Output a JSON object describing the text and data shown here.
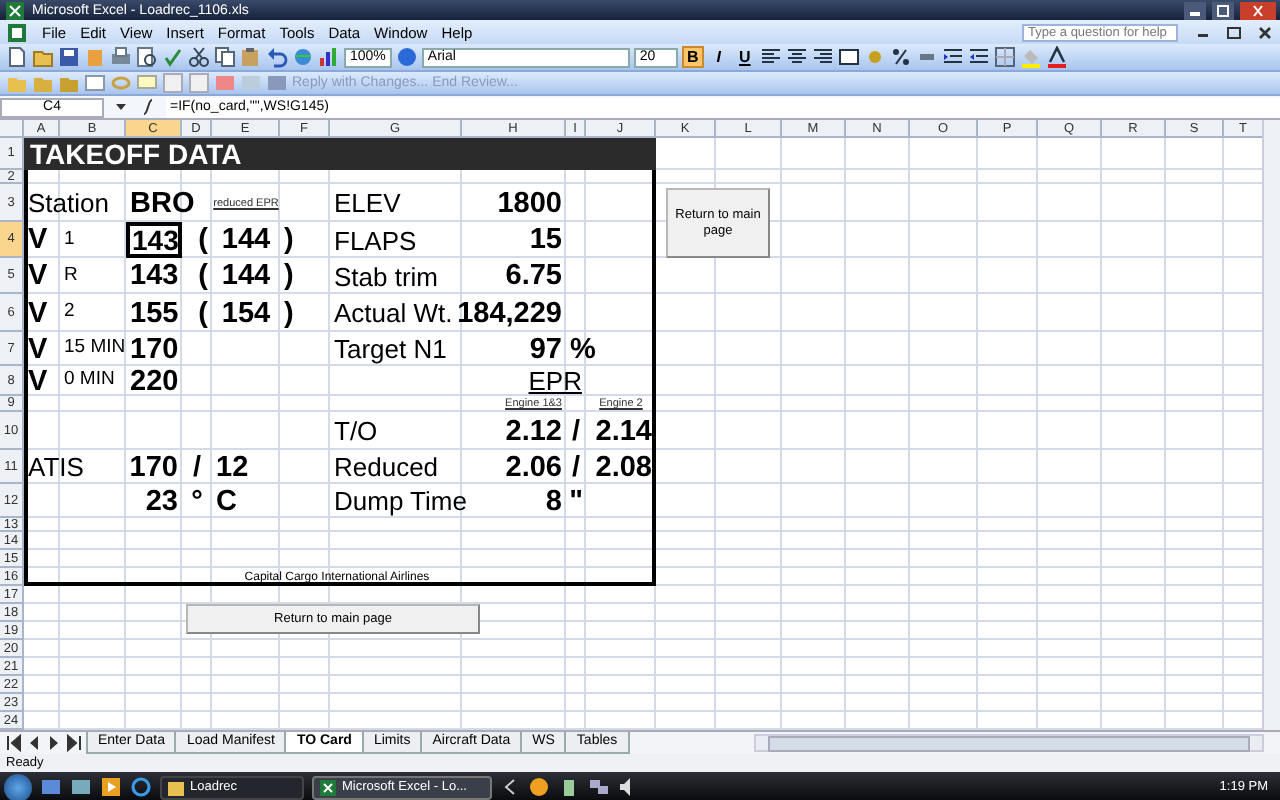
{
  "window": {
    "title": "Microsoft Excel - Loadrec_1106.xls"
  },
  "menu": [
    "File",
    "Edit",
    "View",
    "Insert",
    "Format",
    "Tools",
    "Data",
    "Window",
    "Help"
  ],
  "help": {
    "placeholder": "Type a question for help"
  },
  "toolbar": {
    "zoom": "100%",
    "font": "Arial",
    "size": "20",
    "format_buttons": [
      {
        "kind": "bold",
        "label": "B",
        "on": true
      },
      {
        "kind": "italic",
        "label": "I",
        "on": false
      },
      {
        "kind": "underline",
        "label": "U",
        "on": false
      }
    ]
  },
  "review": {
    "items": [
      "Reply with Changes...",
      "End Review..."
    ],
    "disabled": true
  },
  "formula_bar": {
    "name_box": "C4",
    "formula": "=IF(no_card,\"\",WS!G145)"
  },
  "columns": [
    {
      "label": "A",
      "selected": false
    },
    {
      "label": "B",
      "selected": false
    },
    {
      "label": "C",
      "selected": true
    },
    {
      "label": "D",
      "selected": false
    },
    {
      "label": "E",
      "selected": false
    },
    {
      "label": "F",
      "selected": false
    },
    {
      "label": "G",
      "selected": false
    },
    {
      "label": "H",
      "selected": false
    },
    {
      "label": "I",
      "selected": false
    },
    {
      "label": "J",
      "selected": false
    },
    {
      "label": "K",
      "selected": false
    },
    {
      "label": "L",
      "selected": false
    },
    {
      "label": "M",
      "selected": false
    },
    {
      "label": "N",
      "selected": false
    },
    {
      "label": "O",
      "selected": false
    },
    {
      "label": "P",
      "selected": false
    },
    {
      "label": "Q",
      "selected": false
    },
    {
      "label": "R",
      "selected": false
    },
    {
      "label": "S",
      "selected": false
    },
    {
      "label": "T",
      "selected": false
    }
  ],
  "rows": [
    {
      "label": "1",
      "selected": false
    },
    {
      "label": "2",
      "selected": false
    },
    {
      "label": "3",
      "selected": false
    },
    {
      "label": "4",
      "selected": true
    },
    {
      "label": "5",
      "selected": false
    },
    {
      "label": "6",
      "selected": false
    },
    {
      "label": "7",
      "selected": false
    },
    {
      "label": "8",
      "selected": false
    },
    {
      "label": "9",
      "selected": false
    },
    {
      "label": "10",
      "selected": false
    },
    {
      "label": "11",
      "selected": false
    },
    {
      "label": "12",
      "selected": false
    },
    {
      "label": "13",
      "selected": false
    },
    {
      "label": "14",
      "selected": false
    },
    {
      "label": "15",
      "selected": false
    },
    {
      "label": "16",
      "selected": false
    },
    {
      "label": "17",
      "selected": false
    },
    {
      "label": "18",
      "selected": false
    },
    {
      "label": "19",
      "selected": false
    },
    {
      "label": "20",
      "selected": false
    },
    {
      "label": "21",
      "selected": false
    },
    {
      "label": "22",
      "selected": false
    },
    {
      "label": "23",
      "selected": false
    },
    {
      "label": "24",
      "selected": false
    }
  ],
  "cells": [
    {
      "kind": "title",
      "text": "TAKEOFF DATA",
      "selected": false
    },
    {
      "kind": "label",
      "text": "Station",
      "selected": false
    },
    {
      "kind": "bold",
      "text": "BRO",
      "selected": false
    },
    {
      "kind": "note",
      "text": "reduced EPR",
      "selected": false
    },
    {
      "kind": "label",
      "text": "ELEV",
      "selected": false
    },
    {
      "kind": "bold-right",
      "text": "1800",
      "selected": false
    },
    {
      "kind": "bold",
      "text": "V",
      "selected": false
    },
    {
      "kind": "sub",
      "text": "1",
      "selected": false
    },
    {
      "kind": "bold",
      "text": "143",
      "selected": true
    },
    {
      "kind": "bold-right",
      "text": "(",
      "selected": false
    },
    {
      "kind": "bold-center",
      "text": "144",
      "selected": false
    },
    {
      "kind": "bold",
      "text": ")",
      "selected": false
    },
    {
      "kind": "label",
      "text": "FLAPS",
      "selected": false
    },
    {
      "kind": "bold-right",
      "text": "15",
      "selected": false
    },
    {
      "kind": "bold",
      "text": "V",
      "selected": false
    },
    {
      "kind": "sub",
      "text": "R",
      "selected": false
    },
    {
      "kind": "bold",
      "text": "143",
      "selected": false
    },
    {
      "kind": "bold-right",
      "text": "(",
      "selected": false
    },
    {
      "kind": "bold-center",
      "text": "144",
      "selected": false
    },
    {
      "kind": "bold",
      "text": ")",
      "selected": false
    },
    {
      "kind": "label",
      "text": "Stab trim",
      "selected": false
    },
    {
      "kind": "bold-right",
      "text": "6.75",
      "selected": false
    },
    {
      "kind": "bold",
      "text": "V",
      "selected": false
    },
    {
      "kind": "sub",
      "text": "2",
      "selected": false
    },
    {
      "kind": "bold",
      "text": "155",
      "selected": false
    },
    {
      "kind": "bold-right",
      "text": "(",
      "selected": false
    },
    {
      "kind": "bold-center",
      "text": "154",
      "selected": false
    },
    {
      "kind": "bold",
      "text": ")",
      "selected": false
    },
    {
      "kind": "label",
      "text": "Actual Wt.",
      "selected": false
    },
    {
      "kind": "bold-right",
      "text": "184,229",
      "selected": false
    },
    {
      "kind": "bold",
      "text": "V",
      "selected": false
    },
    {
      "kind": "sub",
      "text": "15 MIN",
      "selected": false
    },
    {
      "kind": "bold",
      "text": "170",
      "selected": false
    },
    {
      "kind": "label",
      "text": "Target N1",
      "selected": false
    },
    {
      "kind": "bold-right",
      "text": "97",
      "selected": false
    },
    {
      "kind": "bold",
      "text": "%",
      "selected": false
    },
    {
      "kind": "bold",
      "text": "V",
      "selected": false
    },
    {
      "kind": "sub",
      "text": "0 MIN",
      "selected": false
    },
    {
      "kind": "bold",
      "text": "220",
      "selected": false
    },
    {
      "kind": "label-underline",
      "text": "EPR",
      "selected": false
    },
    {
      "kind": "note-right",
      "text": "Engine 1&3",
      "selected": false
    },
    {
      "kind": "note",
      "text": "Engine 2",
      "selected": false
    },
    {
      "kind": "label",
      "text": "T/O",
      "selected": false
    },
    {
      "kind": "bold-right",
      "text": "2.12",
      "selected": false
    },
    {
      "kind": "bold-center",
      "text": "/",
      "selected": false
    },
    {
      "kind": "bold-right",
      "text": "2.14",
      "selected": false
    },
    {
      "kind": "label",
      "text": "ATIS",
      "selected": false
    },
    {
      "kind": "bold-right",
      "text": "170",
      "selected": false
    },
    {
      "kind": "bold-center",
      "text": "/",
      "selected": false
    },
    {
      "kind": "bold",
      "text": "12",
      "selected": false
    },
    {
      "kind": "label",
      "text": "Reduced",
      "selected": false
    },
    {
      "kind": "bold-right",
      "text": "2.06",
      "selected": false
    },
    {
      "kind": "bold-center",
      "text": "/",
      "selected": false
    },
    {
      "kind": "bold-right",
      "text": "2.08",
      "selected": false
    },
    {
      "kind": "bold-right",
      "text": "23",
      "selected": false
    },
    {
      "kind": "bold-center",
      "text": "°",
      "selected": false
    },
    {
      "kind": "bold",
      "text": "C",
      "selected": false
    },
    {
      "kind": "label",
      "text": "Dump Time",
      "selected": false
    },
    {
      "kind": "bold-right",
      "text": "8",
      "selected": false
    },
    {
      "kind": "bold-center",
      "text": "\"",
      "selected": false
    },
    {
      "kind": "footer",
      "text": "Capital Cargo International Airlines",
      "selected": false
    }
  ],
  "buttons": [
    {
      "label": "Return to main page",
      "kind": "small"
    },
    {
      "label": "Return to main page",
      "kind": "wide"
    }
  ],
  "sheet_tabs": [
    {
      "label": "Enter Data",
      "selected": false
    },
    {
      "label": "Load Manifest",
      "selected": false
    },
    {
      "label": "TO Card",
      "selected": true
    },
    {
      "label": "Limits",
      "selected": false
    },
    {
      "label": "Aircraft Data",
      "selected": false
    },
    {
      "label": "WS",
      "selected": false
    },
    {
      "label": "Tables",
      "selected": false
    }
  ],
  "status_bar": {
    "text": "Ready"
  },
  "taskbar": {
    "items": [
      {
        "label": "Loadrec",
        "selected": false
      },
      {
        "label": "Microsoft Excel - Lo...",
        "selected": true
      }
    ],
    "clock": "1:19 PM"
  }
}
